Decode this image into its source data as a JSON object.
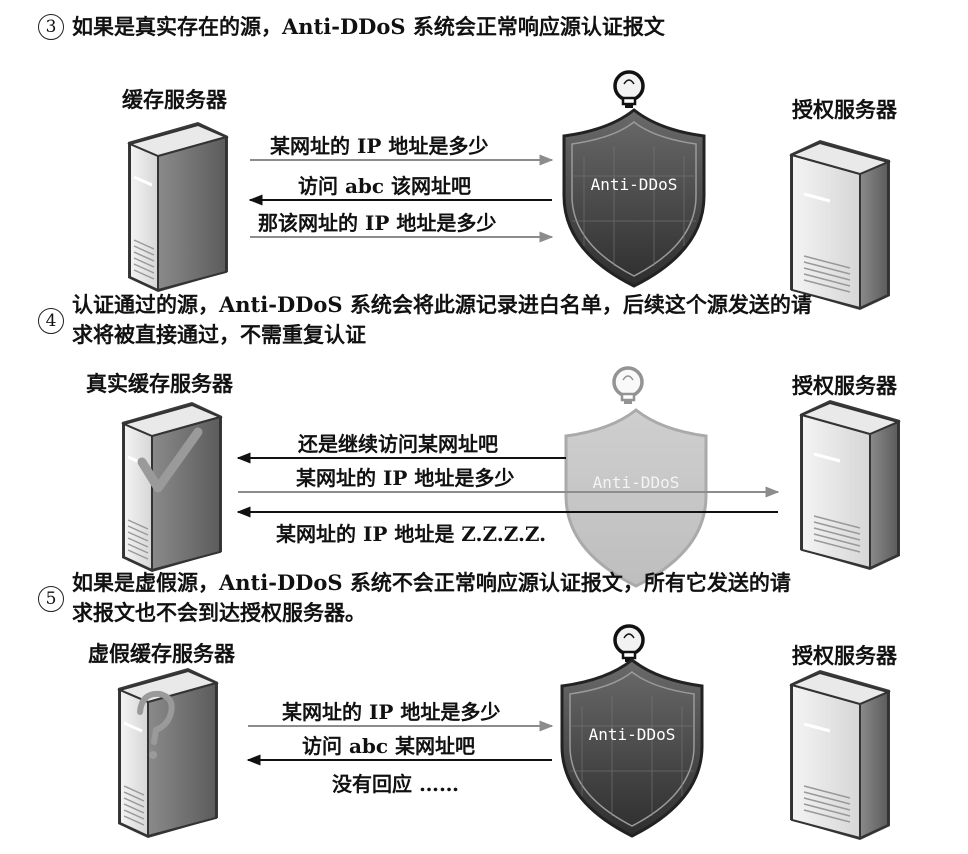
{
  "steps": [
    {
      "number": "3",
      "text_lines": [
        "如果是真实存在的源，Anti-DDoS 系统会正常响应源认证报文"
      ],
      "left_server_label": "缓存服务器",
      "right_server_label": "授权服务器",
      "shield_label": "Anti-DDoS",
      "messages": [
        "某网址的 IP 地址是多少",
        "访问 abc 该网址吧",
        "那该网址的 IP 地址是多少"
      ]
    },
    {
      "number": "4",
      "text_lines": [
        "认证通过的源，Anti-DDoS 系统会将此源记录进白名单，后续这个源发送的请",
        "求将被直接通过，不需重复认证"
      ],
      "left_server_label": "真实缓存服务器",
      "right_server_label": "授权服务器",
      "shield_label": "Anti-DDoS",
      "messages": [
        "还是继续访问某网址吧",
        "某网址的 IP 地址是多少",
        "某网址的 IP 地址是 Z.Z.Z.Z."
      ]
    },
    {
      "number": "5",
      "text_lines": [
        "如果是虚假源，Anti-DDoS 系统不会正常响应源认证报文，所有它发送的请",
        "求报文也不会到达授权服务器。"
      ],
      "left_server_label": "虚假缓存服务器",
      "right_server_label": "授权服务器",
      "shield_label": "Anti-DDoS",
      "messages": [
        "某网址的 IP 地址是多少",
        "访问 abc 某网址吧",
        "没有回应 ……"
      ]
    }
  ],
  "icons": {
    "left_server_3": "server-icon",
    "left_server_4": "server-with-checkmark-icon",
    "left_server_5": "server-with-question-mark-icon",
    "shield": "shield-icon",
    "bulb": "lightbulb-icon"
  }
}
